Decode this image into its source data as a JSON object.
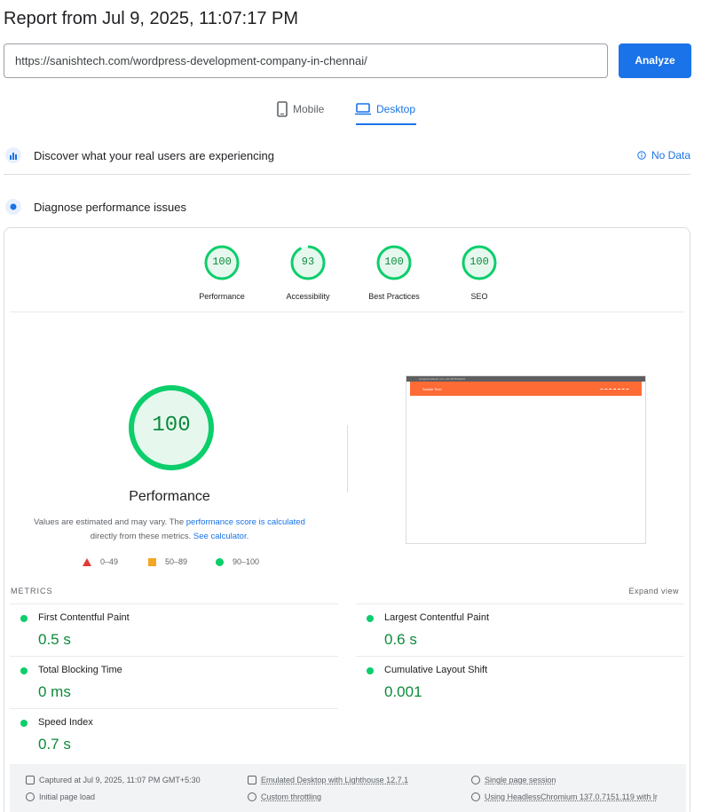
{
  "header": {
    "title": "Report from Jul 9, 2025, 11:07:17 PM",
    "url_value": "https://sanishtech.com/wordpress-development-company-in-chennai/",
    "analyze_label": "Analyze"
  },
  "tabs": [
    {
      "label": "Mobile",
      "selected": false
    },
    {
      "label": "Desktop",
      "selected": true
    }
  ],
  "sections": {
    "discover_label": "Discover what your real users are experiencing",
    "no_data_label": "No Data",
    "diagnose_label": "Diagnose performance issues"
  },
  "scores": [
    {
      "label": "Performance",
      "value": "100",
      "fraction": 1.0
    },
    {
      "label": "Accessibility",
      "value": "93",
      "fraction": 0.93
    },
    {
      "label": "Best Practices",
      "value": "100",
      "fraction": 1.0
    },
    {
      "label": "SEO",
      "value": "100",
      "fraction": 1.0
    }
  ],
  "performance": {
    "value": "100",
    "title": "Performance",
    "note_part1": "Values are estimated and may vary. The ",
    "note_link1": "performance score is calculated",
    "note_part2": "directly from these metrics. ",
    "note_link2": "See calculator."
  },
  "legend": [
    {
      "range": "0–49",
      "shape": "triangle",
      "color": "#e53935"
    },
    {
      "range": "50–89",
      "shape": "square",
      "color": "#f5a623"
    },
    {
      "range": "90–100",
      "shape": "circle",
      "color": "#0cce6b"
    }
  ],
  "screenshot": {
    "site_name": "Sanish Tech",
    "top_text": "info@sanishtech.com  +91 9876543210"
  },
  "metrics_header": {
    "label": "METRICS",
    "expand_label": "Expand view"
  },
  "metrics": [
    {
      "name": "First Contentful Paint",
      "value": "0.5 s"
    },
    {
      "name": "Largest Contentful Paint",
      "value": "0.6 s"
    },
    {
      "name": "Total Blocking Time",
      "value": "0 ms"
    },
    {
      "name": "Cumulative Layout Shift",
      "value": "0.001"
    },
    {
      "name": "Speed Index",
      "value": "0.7 s"
    }
  ],
  "footer": {
    "captured": "Captured at Jul 9, 2025, 11:07 PM GMT+5:30",
    "initial_load": "Initial page load",
    "emulated": "Emulated Desktop with Lighthouse 12.7.1",
    "throttling": "Custom throttling",
    "session": "Single page session",
    "browser": "Using HeadlessChromium 137.0.7151.119 with lr"
  },
  "colors": {
    "accent": "#1a73e8",
    "pass": "#0cce6b",
    "pass_text": "#0c8a3a"
  }
}
